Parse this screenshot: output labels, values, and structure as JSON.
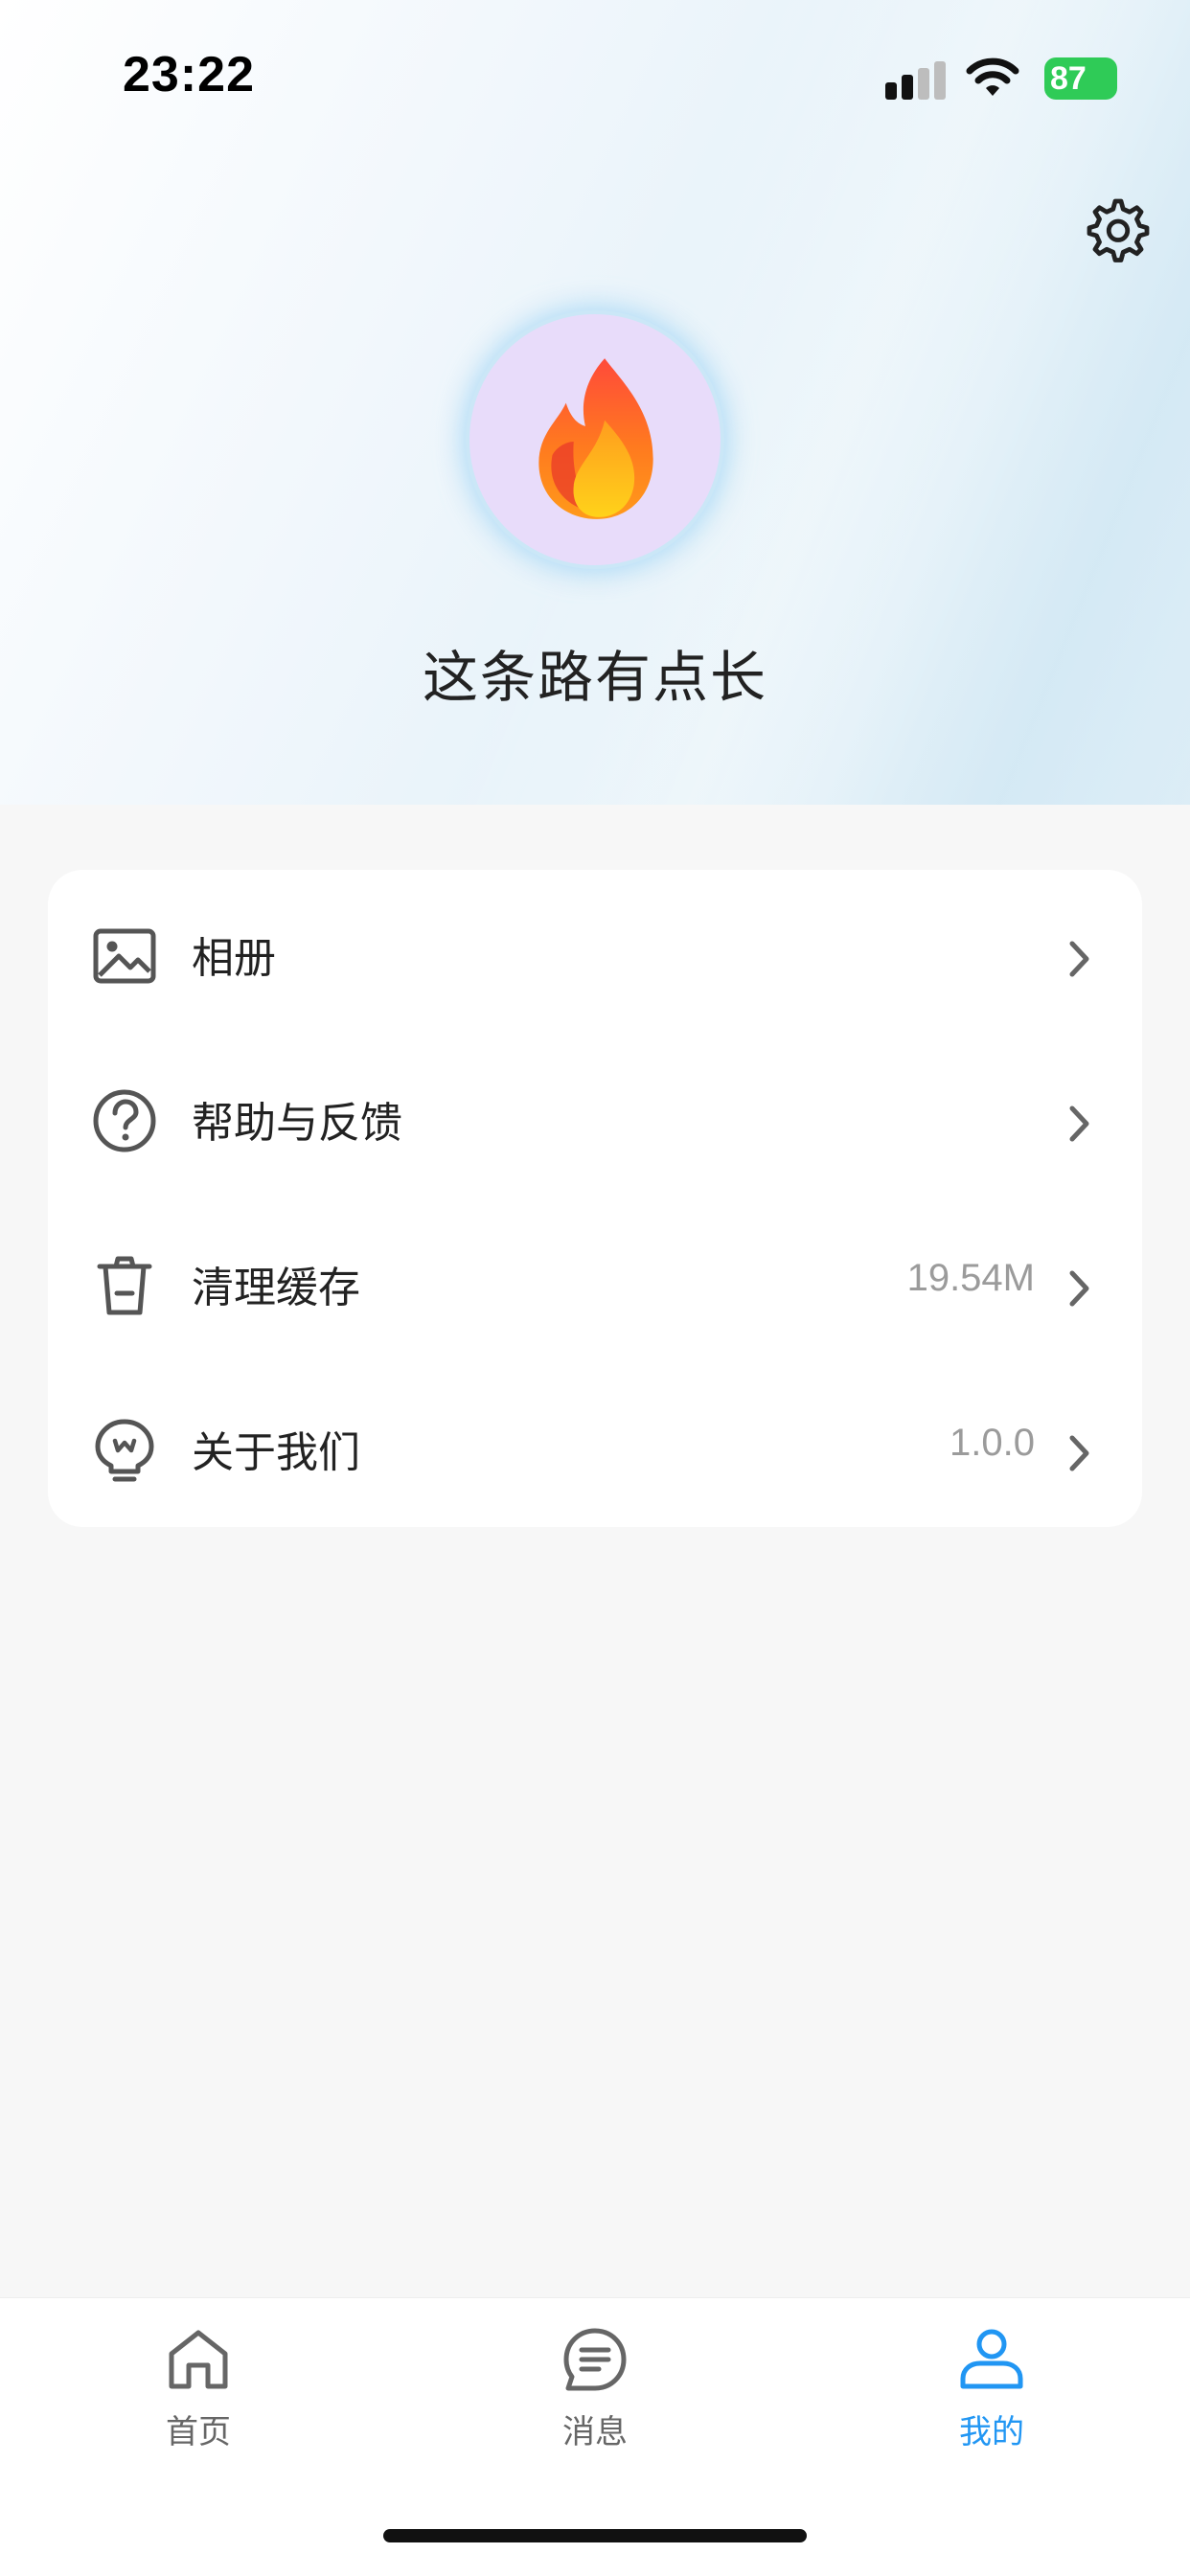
{
  "status_bar": {
    "time": "23:22",
    "battery": "87",
    "icons": [
      "signal-icon",
      "wifi-icon",
      "battery-charging-icon"
    ]
  },
  "profile": {
    "username": "这条路有点长",
    "avatar_icon": "flame-icon",
    "settings_icon": "gear-icon"
  },
  "menu": {
    "items": [
      {
        "label": "相册",
        "value": "",
        "icon": "image-icon"
      },
      {
        "label": "帮助与反馈",
        "value": "",
        "icon": "help-circle-icon"
      },
      {
        "label": "清理缓存",
        "value": "19.54M",
        "icon": "trash-icon"
      },
      {
        "label": "关于我们",
        "value": "1.0.0",
        "icon": "bulb-icon"
      }
    ]
  },
  "tabbar": {
    "tabs": [
      {
        "label": "首页",
        "icon": "home-icon",
        "active": false
      },
      {
        "label": "消息",
        "icon": "message-icon",
        "active": false
      },
      {
        "label": "我的",
        "icon": "user-icon",
        "active": true
      }
    ]
  },
  "colors": {
    "accent": "#2196f3",
    "battery": "#2fcb57",
    "icon_gray": "#555555",
    "value_gray": "#9b9b9b"
  }
}
